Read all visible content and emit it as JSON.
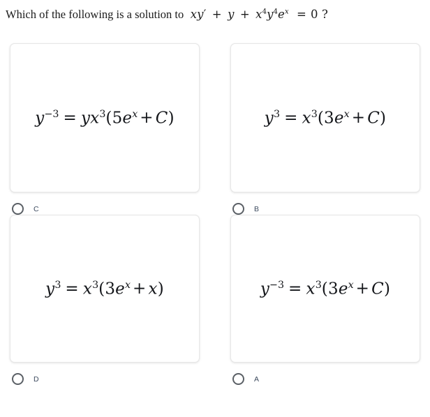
{
  "question": {
    "lead": "Which of the following is a solution to",
    "equation_plain": "xy' + y + x^4 y^4 e^x = 0 ?",
    "parts": {
      "x1": "x",
      "y1": "y",
      "prime": "′",
      "plus1": "+",
      "y2": "y",
      "plus2": "+",
      "x2": "x",
      "x2_sup": "4",
      "y3": "y",
      "y3_sup": "4",
      "e1": "e",
      "e1_sup": "x",
      "equals": "=",
      "zero": "0",
      "qmark": "?"
    }
  },
  "choices": [
    {
      "letter": "C",
      "selected": false,
      "formula_plain": "y^-3 = yx^3(5e^x + C)",
      "parts": {
        "lhs_base": "y",
        "lhs_sup": "−3",
        "eq": "=",
        "rhs_coeff": "yx",
        "rhs_sup": "3",
        "open": "(",
        "inner_num": "5",
        "inner_e": "e",
        "inner_e_sup": "x",
        "inner_op": "+",
        "inner_const": "C",
        "close": ")"
      }
    },
    {
      "letter": "B",
      "selected": false,
      "formula_plain": "y^3 = x^3(3e^x + C)",
      "parts": {
        "lhs_base": "y",
        "lhs_sup": "3",
        "eq": "=",
        "rhs_coeff": "x",
        "rhs_sup": "3",
        "open": "(",
        "inner_num": "3",
        "inner_e": "e",
        "inner_e_sup": "x",
        "inner_op": "+",
        "inner_const": "C",
        "close": ")"
      }
    },
    {
      "letter": "D",
      "selected": false,
      "formula_plain": "y^3 = x^3(3e^x + x)",
      "parts": {
        "lhs_base": "y",
        "lhs_sup": "3",
        "eq": "=",
        "rhs_coeff": "x",
        "rhs_sup": "3",
        "open": "(",
        "inner_num": "3",
        "inner_e": "e",
        "inner_e_sup": "x",
        "inner_op": "+",
        "inner_const": "x",
        "close": ")"
      }
    },
    {
      "letter": "A",
      "selected": false,
      "formula_plain": "y^-3 = x^3(3e^x + C)",
      "parts": {
        "lhs_base": "y",
        "lhs_sup": "−3",
        "eq": "=",
        "rhs_coeff": "x",
        "rhs_sup": "3",
        "open": "(",
        "inner_num": "3",
        "inner_e": "e",
        "inner_e_sup": "x",
        "inner_op": "+",
        "inner_const": "C",
        "close": ")"
      }
    }
  ],
  "colors": {
    "page_background": "#ffffff",
    "text": "#1b1b1b",
    "formula_text": "#14161a",
    "card_border": "#e7e7e7",
    "radio_border": "#5b6066",
    "answer_letter": "#3c4a5e"
  }
}
